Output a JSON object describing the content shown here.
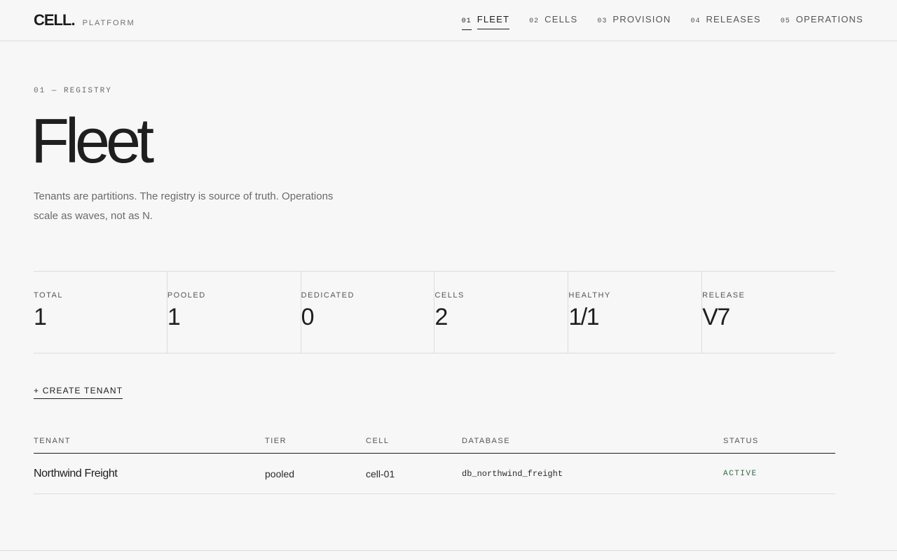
{
  "brand": {
    "logo": "CELL.",
    "sub": "PLATFORM"
  },
  "nav": [
    {
      "num": "01",
      "label": "FLEET",
      "active": true
    },
    {
      "num": "02",
      "label": "CELLS"
    },
    {
      "num": "03",
      "label": "PROVISION"
    },
    {
      "num": "04",
      "label": "RELEASES"
    },
    {
      "num": "05",
      "label": "OPERATIONS"
    }
  ],
  "hero": {
    "eyebrow": "01 — REGISTRY",
    "title": "Fleet",
    "lede": "Tenants are partitions. The registry is source of truth. Operations scale as waves, not as N."
  },
  "stats": [
    {
      "label": "TOTAL",
      "value": "1"
    },
    {
      "label": "POOLED",
      "value": "1"
    },
    {
      "label": "DEDICATED",
      "value": "0"
    },
    {
      "label": "CELLS",
      "value": "2"
    },
    {
      "label": "HEALTHY",
      "value": "1/1"
    },
    {
      "label": "RELEASE",
      "value": "V7"
    }
  ],
  "actions": {
    "create_label": "+ CREATE TENANT"
  },
  "table": {
    "columns": [
      "TENANT",
      "TIER",
      "CELL",
      "DATABASE",
      "STATUS"
    ],
    "rows": [
      {
        "tenant": "Northwind Freight",
        "tier": "pooled",
        "cell": "cell-01",
        "database": "db_northwind_freight",
        "status": "ACTIVE"
      }
    ]
  },
  "colors": {
    "status_active": "#2f6b47",
    "text": "#1c1c1c",
    "background": "#f7f7f7"
  }
}
